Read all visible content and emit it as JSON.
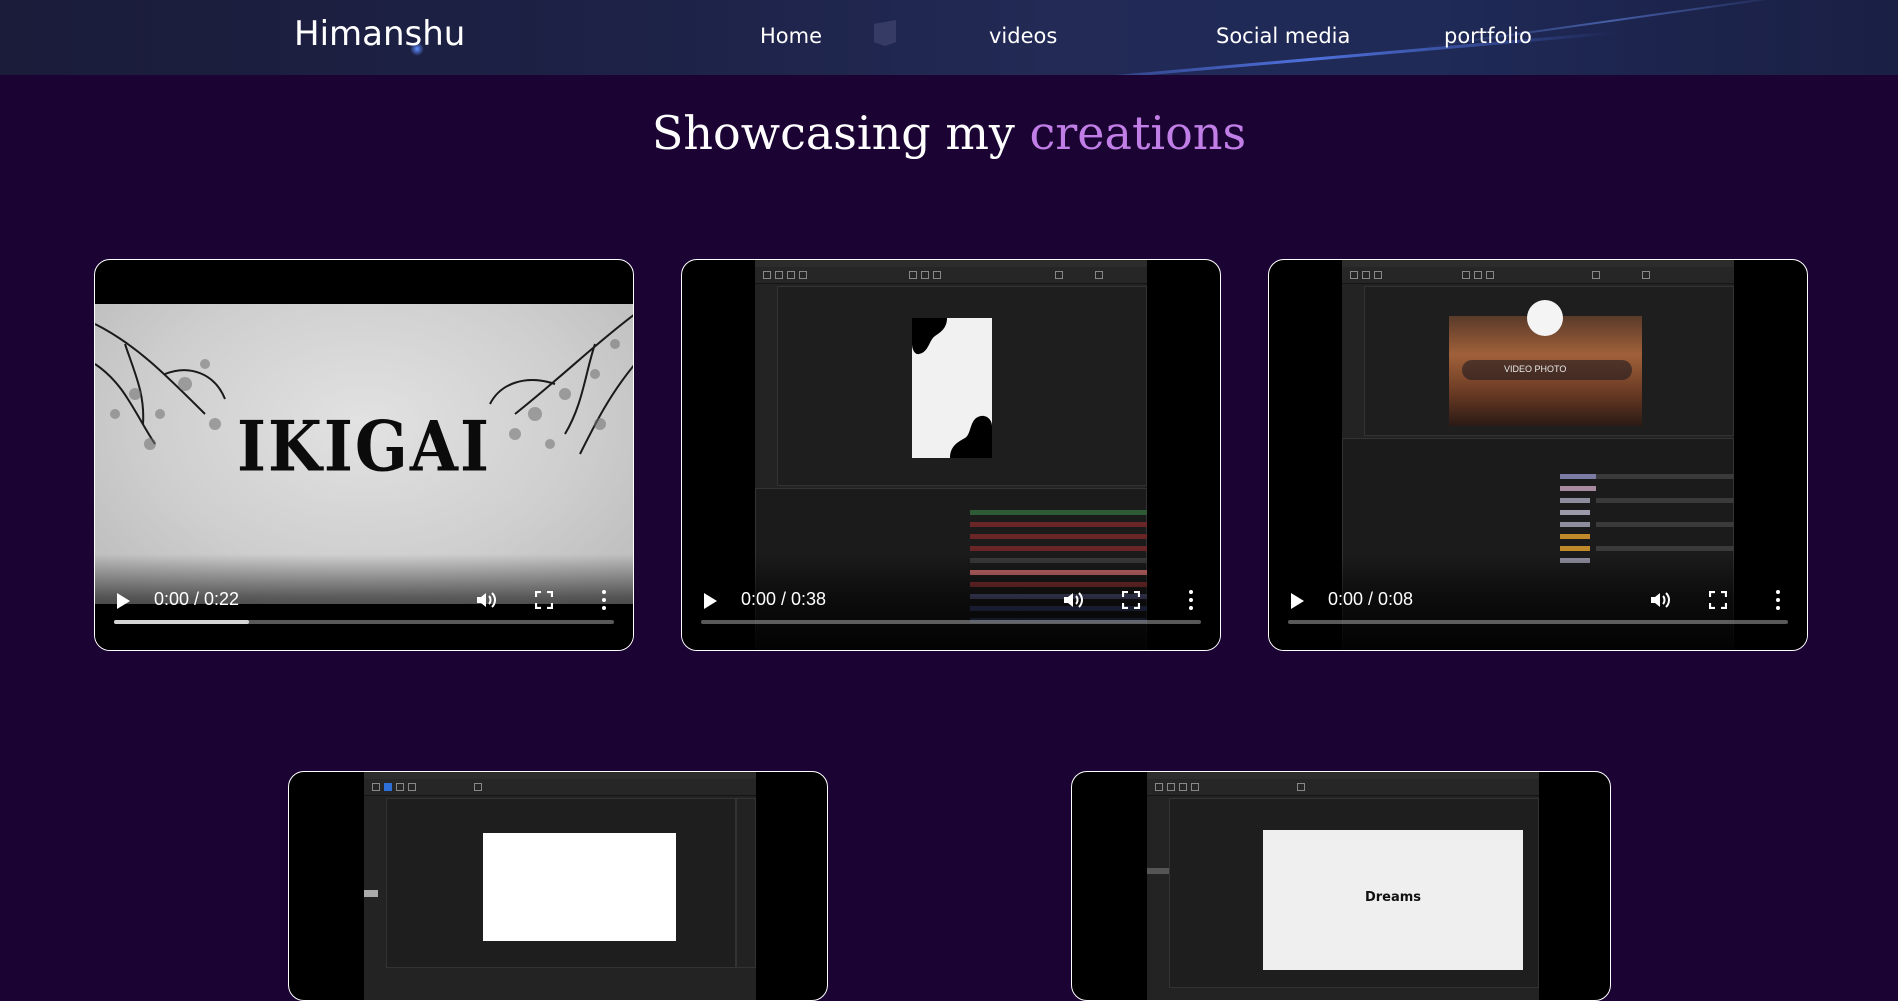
{
  "navbar": {
    "brand": "Himanshu",
    "links": [
      "Home",
      "videos",
      "Social media",
      "portfolio"
    ]
  },
  "heading": {
    "prefix": "Showcasing my ",
    "accent": "creations"
  },
  "videos": [
    {
      "time": "0:00 / 0:22",
      "thumb_text": "IKIGAI",
      "buffered": 0.27
    },
    {
      "time": "0:00 / 0:38"
    },
    {
      "time": "0:00 / 0:08",
      "thumb_text": "VIDEO   PHOTO"
    },
    {
      "time": ""
    },
    {
      "time": "",
      "thumb_text": "Dreams"
    }
  ],
  "icons": {
    "play": "play-icon",
    "volume": "volume-icon",
    "fullscreen": "fullscreen-icon",
    "more": "more-vertical-icon"
  },
  "colors": {
    "background": "#1b0433",
    "accent": "#c07ee6",
    "card_border": "#ffffff"
  }
}
